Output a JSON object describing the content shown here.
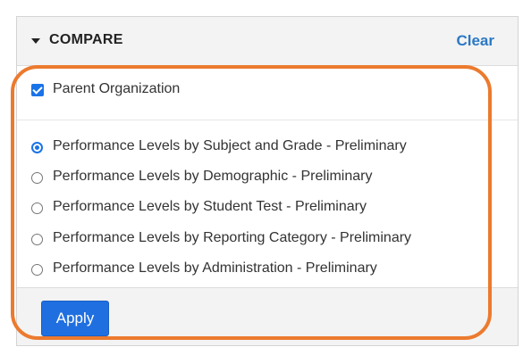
{
  "compare": {
    "title": "COMPARE",
    "clear_label": "Clear",
    "parent_organization": {
      "label": "Parent Organization",
      "checked": true
    },
    "options": [
      {
        "label": "Performance Levels by Subject and Grade - Preliminary",
        "selected": true
      },
      {
        "label": "Performance Levels by Demographic - Preliminary",
        "selected": false
      },
      {
        "label": "Performance Levels by Student Test - Preliminary",
        "selected": false
      },
      {
        "label": "Performance Levels by Reporting Category - Preliminary",
        "selected": false
      },
      {
        "label": "Performance Levels by Administration - Preliminary",
        "selected": false
      }
    ],
    "apply_label": "Apply"
  },
  "colors": {
    "accent": "#1a73e8",
    "link": "#2b78c4",
    "apply_button": "#1f6fe0",
    "highlight": "#ec7a2e"
  }
}
